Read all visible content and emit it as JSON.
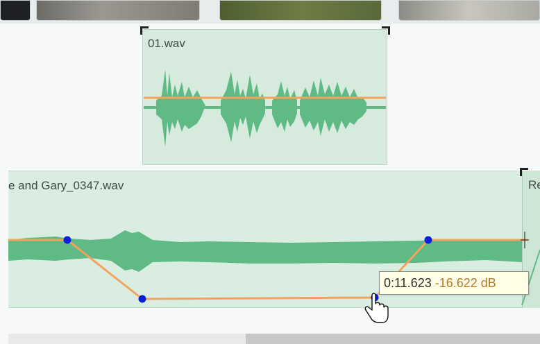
{
  "clips": {
    "top": {
      "name": "01.wav"
    },
    "main": {
      "name": "e and Gary_0347.wav"
    },
    "next": {
      "name": "Re"
    }
  },
  "tooltip": {
    "time": "0:11.623",
    "gain": "-16.622 dB"
  },
  "colors": {
    "waveform": "#5fba85",
    "envelope": "#f4a35e",
    "keypoint": "#0b20d8",
    "clip_bg": "#d9eee0",
    "tooltip_bg": "#fffde6",
    "tooltip_value": "#b57a28"
  },
  "icons": {
    "cursor": "hand-pointer-icon"
  }
}
